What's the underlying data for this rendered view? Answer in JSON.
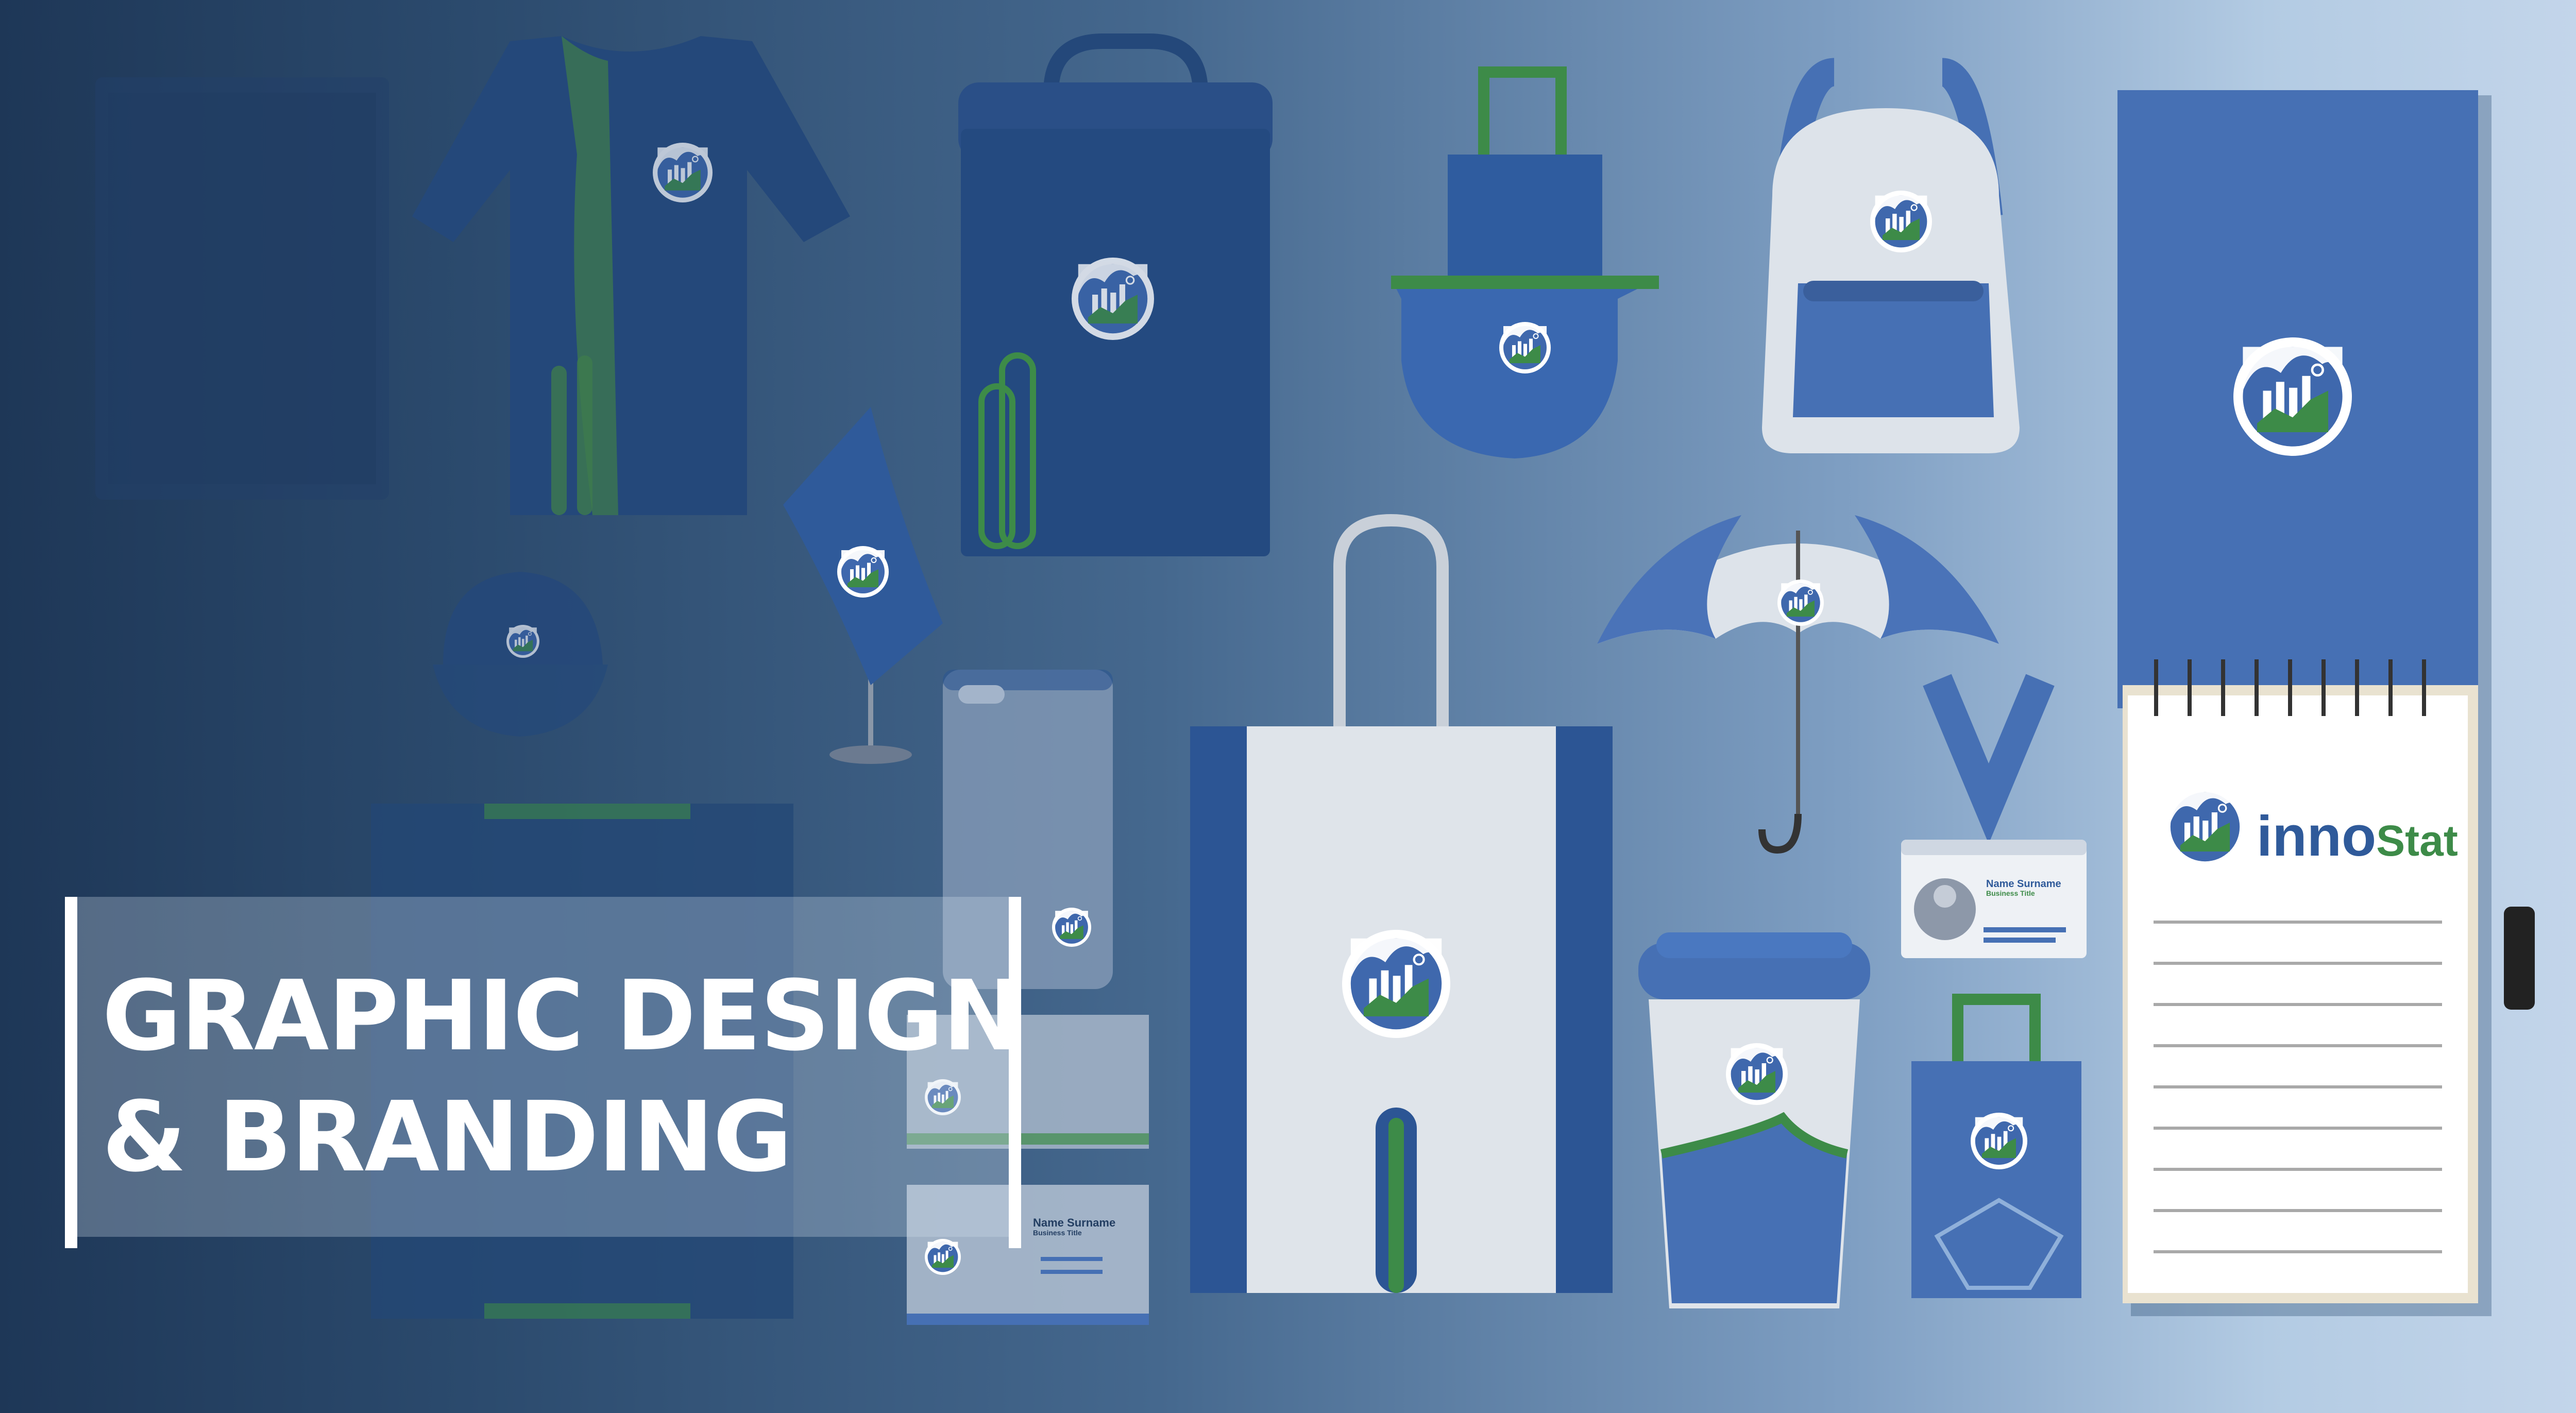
{
  "banner": {
    "headline_line1": "GRAPHIC DESIGN",
    "headline_line2": "& BRANDING"
  },
  "brand": {
    "name_part1": "inno",
    "name_part2": "Stat",
    "colors": {
      "blue": "#4670b4",
      "dark_blue": "#2b5591",
      "green": "#3d8b48",
      "navy_bg": "#1e3757",
      "light_bg": "#c3d5ea"
    }
  },
  "id_badge": {
    "name": "Name Surname",
    "title": "Business Title"
  },
  "business_card": {
    "name": "Name Surname",
    "title": "Business Title"
  }
}
